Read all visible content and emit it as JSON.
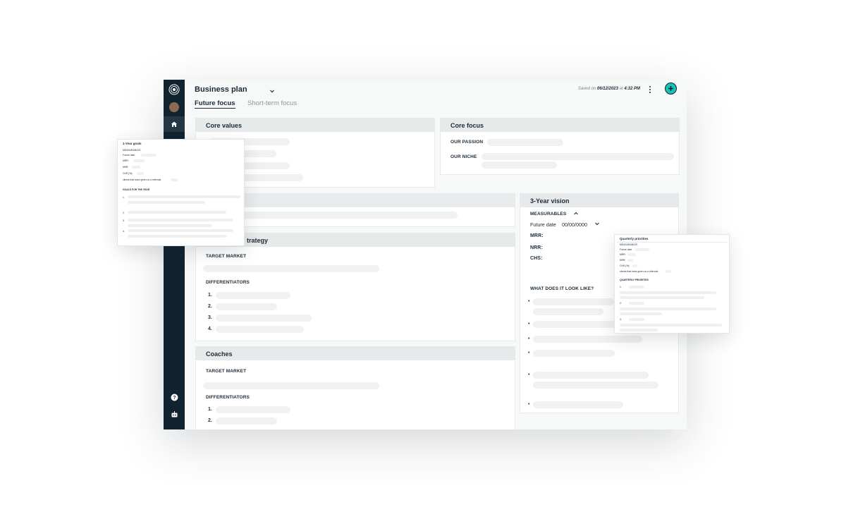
{
  "header": {
    "title": "Business plan",
    "saved_prefix": "Saved on",
    "saved_date": "06/12/2023",
    "saved_mid": "at",
    "saved_time": "4:32 PM"
  },
  "tabs": [
    {
      "label": "Future focus",
      "active": true
    },
    {
      "label": "Short-term focus",
      "active": false
    }
  ],
  "core_values": {
    "title": "Core values"
  },
  "core_focus": {
    "title": "Core focus",
    "passion_label": "OUR PASSION",
    "niche_label": "OUR NICHE"
  },
  "strategy": {
    "title": "Marketing strategy",
    "title_visible": "trategy",
    "target_market_label": "TARGET MARKET",
    "differentiators_label": "DIFFERENTIATORS",
    "numbers": [
      "1.",
      "2.",
      "3.",
      "4."
    ]
  },
  "coaches": {
    "title": "Coaches",
    "target_market_label": "TARGET MARKET",
    "differentiators_label": "DIFFERENTIATORS",
    "numbers": [
      "1.",
      "2."
    ]
  },
  "vision": {
    "title": "3-Year vision",
    "measurables_label": "MEASURABLES",
    "future_date_label": "Future date",
    "future_date_value": "00/00/0000",
    "mrr_label": "MRR:",
    "nrr_label": "NRR:",
    "chs_label": "CHS:",
    "look_like_label": "WHAT DOES IT LOOK LIKE?"
  },
  "left_popup": {
    "title": "1-Year goals",
    "measurables": "MEASURABLES",
    "future_date": "Future date",
    "mrr": "MRR:",
    "nrr": "NRR:",
    "chs": "CHS (%):",
    "clients_note": "clients that have given us a referrals",
    "goals_title": "GOALS FOR THE YEAR",
    "numbers": [
      "1.",
      "2.",
      "3.",
      "4."
    ]
  },
  "right_popup": {
    "title": "Quarterly priorities",
    "measurables": "MEASURABLES",
    "future_date": "Future date",
    "mrr": "MRR:",
    "nrr": "NRR:",
    "chs": "CHS (%):",
    "clients_note": "clients that have given us a referrals",
    "priorities_title": "QUARTERLY PRIORITIES",
    "numbers": [
      "1.",
      "2.",
      "3."
    ]
  },
  "icons": {
    "logo": "target-logo-icon",
    "home": "home-icon",
    "help": "help-circle-icon",
    "bot": "robot-icon",
    "add": "plus-icon",
    "more": "kebab-menu-icon",
    "caret": "chevron-down-icon"
  },
  "colors": {
    "sidebar": "#10232f",
    "accent": "#19c3b4",
    "card_header": "#e7eaeb"
  }
}
